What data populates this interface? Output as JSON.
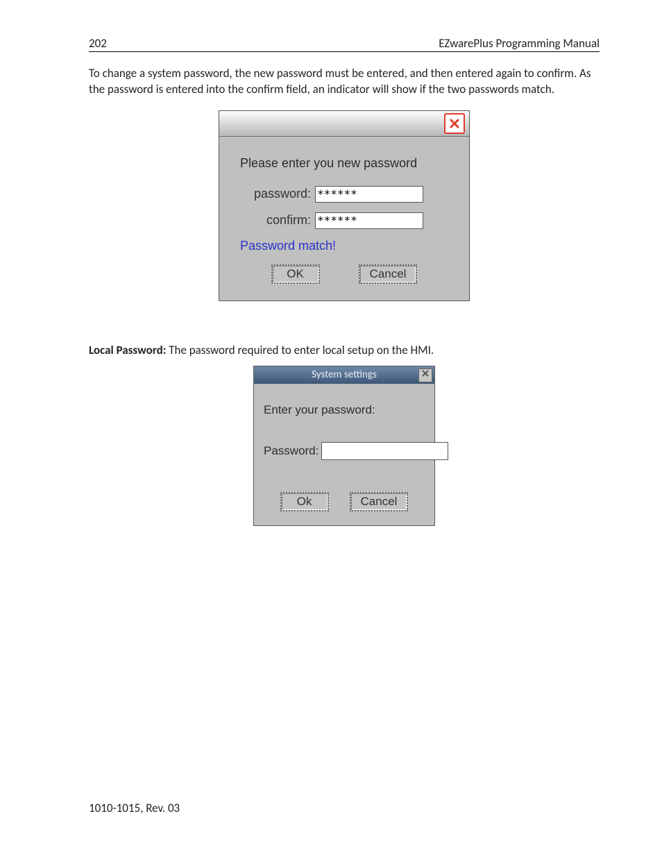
{
  "header": {
    "page_number": "202",
    "doc_title": "EZwarePlus Programming Manual"
  },
  "intro_paragraph": "To change a system password, the new password must be entered, and then entered again to confirm. As the password is entered into the confirm field, an indicator will show if the two passwords match.",
  "dialog1": {
    "prompt": "Please enter you new password",
    "password_label": "password:",
    "password_value": "******",
    "confirm_label": "confirm:",
    "confirm_value": "******",
    "status_text": "Password match!",
    "ok_label": "OK",
    "cancel_label": "Cancel"
  },
  "local_password_section": {
    "heading": "Local Password:",
    "text": " The password required to enter local setup on the HMI."
  },
  "dialog2": {
    "title": "System settings",
    "prompt": "Enter your password:",
    "password_label": "Password:",
    "password_value": "",
    "ok_label": "Ok",
    "cancel_label": "Cancel"
  },
  "footer": {
    "rev": "1010-1015, Rev. 03"
  }
}
